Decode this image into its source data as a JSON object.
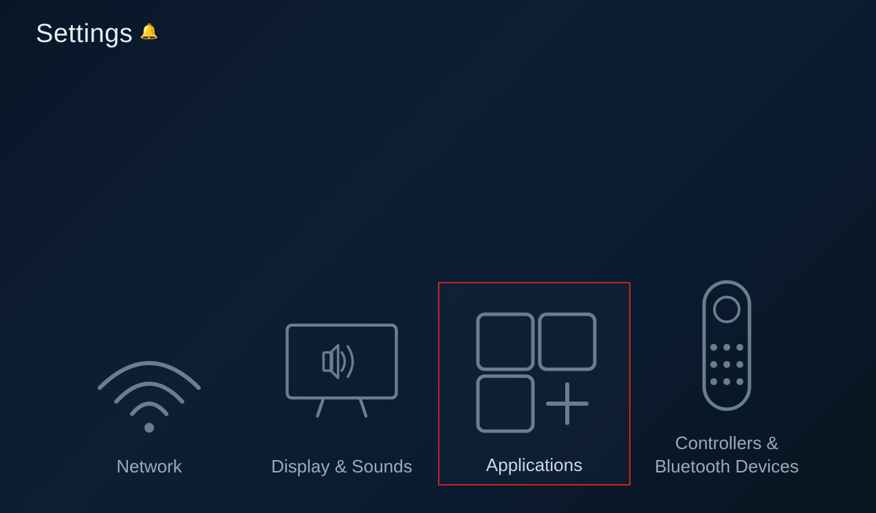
{
  "page": {
    "title": "Settings",
    "bell_icon": "🔔"
  },
  "items": [
    {
      "id": "network",
      "label": "Network",
      "selected": false
    },
    {
      "id": "display-sounds",
      "label": "Display & Sounds",
      "selected": false
    },
    {
      "id": "applications",
      "label": "Applications",
      "selected": true
    },
    {
      "id": "controllers-bluetooth",
      "label": "Controllers & Bluetooth Devices",
      "selected": false
    }
  ],
  "colors": {
    "background": "#0a1628",
    "icon_stroke": "#6a7e8e",
    "selected_border": "#cc2222",
    "label_default": "#8a9eb0",
    "label_selected": "#c8d8e8",
    "title": "#e8edf2"
  }
}
